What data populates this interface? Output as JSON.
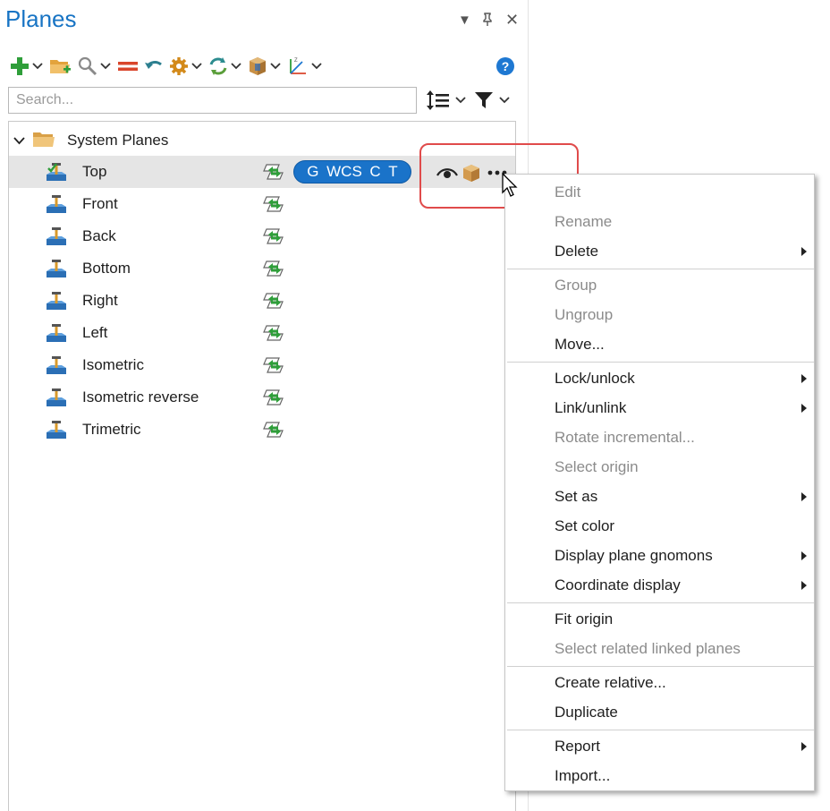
{
  "panel": {
    "title": "Planes",
    "window_buttons": {
      "dropdown": "▾",
      "pin": "📌",
      "close": "✕"
    }
  },
  "toolbar": {
    "icons": [
      "add-icon",
      "open-folder-icon",
      "search-zoom-icon",
      "equal-icon",
      "undo-icon",
      "gear-icon",
      "refresh-icon",
      "box-view-icon",
      "axis-gnomon-icon"
    ],
    "help": "?"
  },
  "search": {
    "placeholder": "Search...",
    "value": ""
  },
  "tree": {
    "group_label": "System Planes",
    "rows": [
      {
        "label": "Top",
        "selected": true
      },
      {
        "label": "Front"
      },
      {
        "label": "Back"
      },
      {
        "label": "Bottom"
      },
      {
        "label": "Right"
      },
      {
        "label": "Left"
      },
      {
        "label": "Isometric"
      },
      {
        "label": "Isometric reverse"
      },
      {
        "label": "Trimetric"
      }
    ],
    "badges": [
      "G",
      "WCS",
      "C",
      "T"
    ]
  },
  "context_menu": {
    "items": [
      {
        "label": "Edit",
        "disabled": true,
        "submenu": false
      },
      {
        "label": "Rename",
        "disabled": true,
        "submenu": false
      },
      {
        "label": "Delete",
        "disabled": false,
        "submenu": true
      },
      {
        "label": "Group",
        "disabled": true,
        "submenu": false
      },
      {
        "label": "Ungroup",
        "disabled": true,
        "submenu": false
      },
      {
        "label": "Move...",
        "disabled": false,
        "submenu": false
      },
      {
        "label": "Lock/unlock",
        "disabled": false,
        "submenu": true
      },
      {
        "label": "Link/unlink",
        "disabled": false,
        "submenu": true
      },
      {
        "label": "Rotate incremental...",
        "disabled": true,
        "submenu": false
      },
      {
        "label": "Select origin",
        "disabled": true,
        "submenu": false
      },
      {
        "label": "Set as",
        "disabled": false,
        "submenu": true
      },
      {
        "label": "Set color",
        "disabled": false,
        "submenu": false
      },
      {
        "label": "Display plane gnomons",
        "disabled": false,
        "submenu": true
      },
      {
        "label": "Coordinate display",
        "disabled": false,
        "submenu": true
      },
      {
        "label": "Fit origin",
        "disabled": false,
        "submenu": false
      },
      {
        "label": "Select related linked planes",
        "disabled": true,
        "submenu": false
      },
      {
        "label": "Create relative...",
        "disabled": false,
        "submenu": false
      },
      {
        "label": "Duplicate",
        "disabled": false,
        "submenu": false
      },
      {
        "label": "Report",
        "disabled": false,
        "submenu": true
      },
      {
        "label": "Import...",
        "disabled": false,
        "submenu": false
      }
    ]
  },
  "colors": {
    "accent": "#1874c4",
    "pill": "#1a73c9",
    "highlight": "#e04b4b",
    "selected_row": "#e5e5e5",
    "disabled_text": "#8b8b8b"
  }
}
